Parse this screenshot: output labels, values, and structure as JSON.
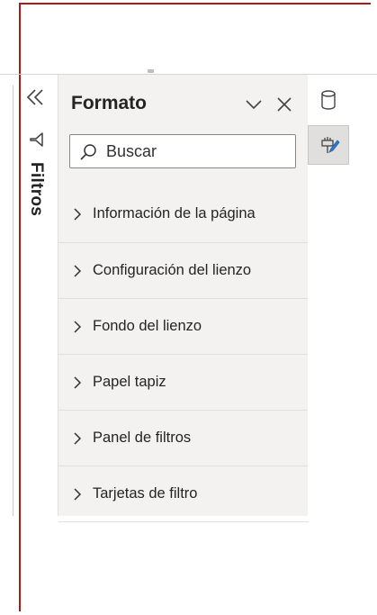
{
  "filters_pane": {
    "label": "Filtros",
    "collapse_icon": "double-chevron-left-icon",
    "filter_icon": "filter-icon"
  },
  "format_pane": {
    "title": "Formato",
    "collapse_icon": "chevron-down-icon",
    "close_icon": "close-icon",
    "search": {
      "placeholder": "Buscar",
      "value": ""
    },
    "sections": [
      {
        "label": "Información de la página"
      },
      {
        "label": "Configuración del lienzo"
      },
      {
        "label": "Fondo del lienzo"
      },
      {
        "label": "Papel tapiz"
      },
      {
        "label": "Panel de filtros"
      },
      {
        "label": "Tarjetas de filtro"
      }
    ]
  },
  "right_rail": {
    "items": [
      {
        "icon": "data-cylinder-icon",
        "active": false
      },
      {
        "icon": "format-paintbrush-icon",
        "active": true
      }
    ]
  },
  "colors": {
    "frame_border": "#b01717",
    "pane_background": "#f3f2f1",
    "accent_blue": "#2b7bd3"
  }
}
